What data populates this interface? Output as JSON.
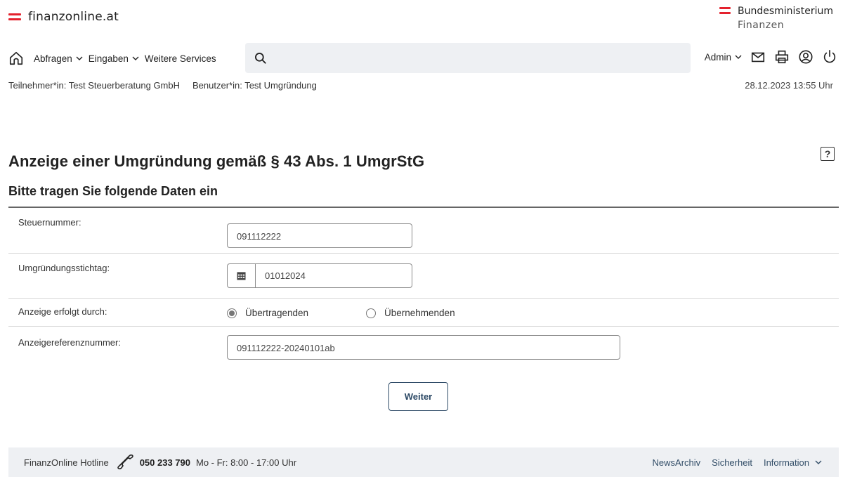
{
  "header": {
    "logo_text": "finanzonline.at",
    "ministry_line1": "Bundesministerium",
    "ministry_line2": "Finanzen",
    "brand_color": "#e4222e"
  },
  "nav": {
    "items": [
      {
        "label": "Abfragen",
        "has_dropdown": true
      },
      {
        "label": "Eingaben",
        "has_dropdown": true
      },
      {
        "label": "Weitere Services",
        "has_dropdown": false
      }
    ],
    "search_value": "",
    "admin_label": "Admin",
    "icons": [
      "home-icon",
      "search-icon",
      "mail-icon",
      "printer-icon",
      "user-icon",
      "power-icon"
    ]
  },
  "info": {
    "teilnehmer": "Teilnehmer*in: Test Steuerberatung GmbH",
    "benutzer": "Benutzer*in: Test Umgründung",
    "timestamp": "28.12.2023 13:55 Uhr"
  },
  "page": {
    "title": "Anzeige einer Umgründung gemäß § 43 Abs. 1 UmgrStG",
    "help_label": "?",
    "section_title": "Bitte tragen Sie folgende Daten ein"
  },
  "form": {
    "steuernummer_label": "Steuernummer:",
    "steuernummer_value": "091112222",
    "stichtag_label": "Umgründungsstichtag:",
    "stichtag_value": "01012024",
    "anzeige_label": "Anzeige erfolgt durch:",
    "radio_options": [
      {
        "label": "Übertragenden",
        "selected": true
      },
      {
        "label": "Übernehmenden",
        "selected": false
      }
    ],
    "referenz_label": "Anzeigereferenznummer:",
    "referenz_value": "091112222-20240101ab",
    "submit_label": "Weiter"
  },
  "footer": {
    "hotline_label": "FinanzOnline Hotline",
    "hotline_number": "050 233 790",
    "hours": "Mo - Fr: 8:00 - 17:00 Uhr",
    "links": [
      "NewsArchiv",
      "Sicherheit",
      "Information"
    ]
  }
}
